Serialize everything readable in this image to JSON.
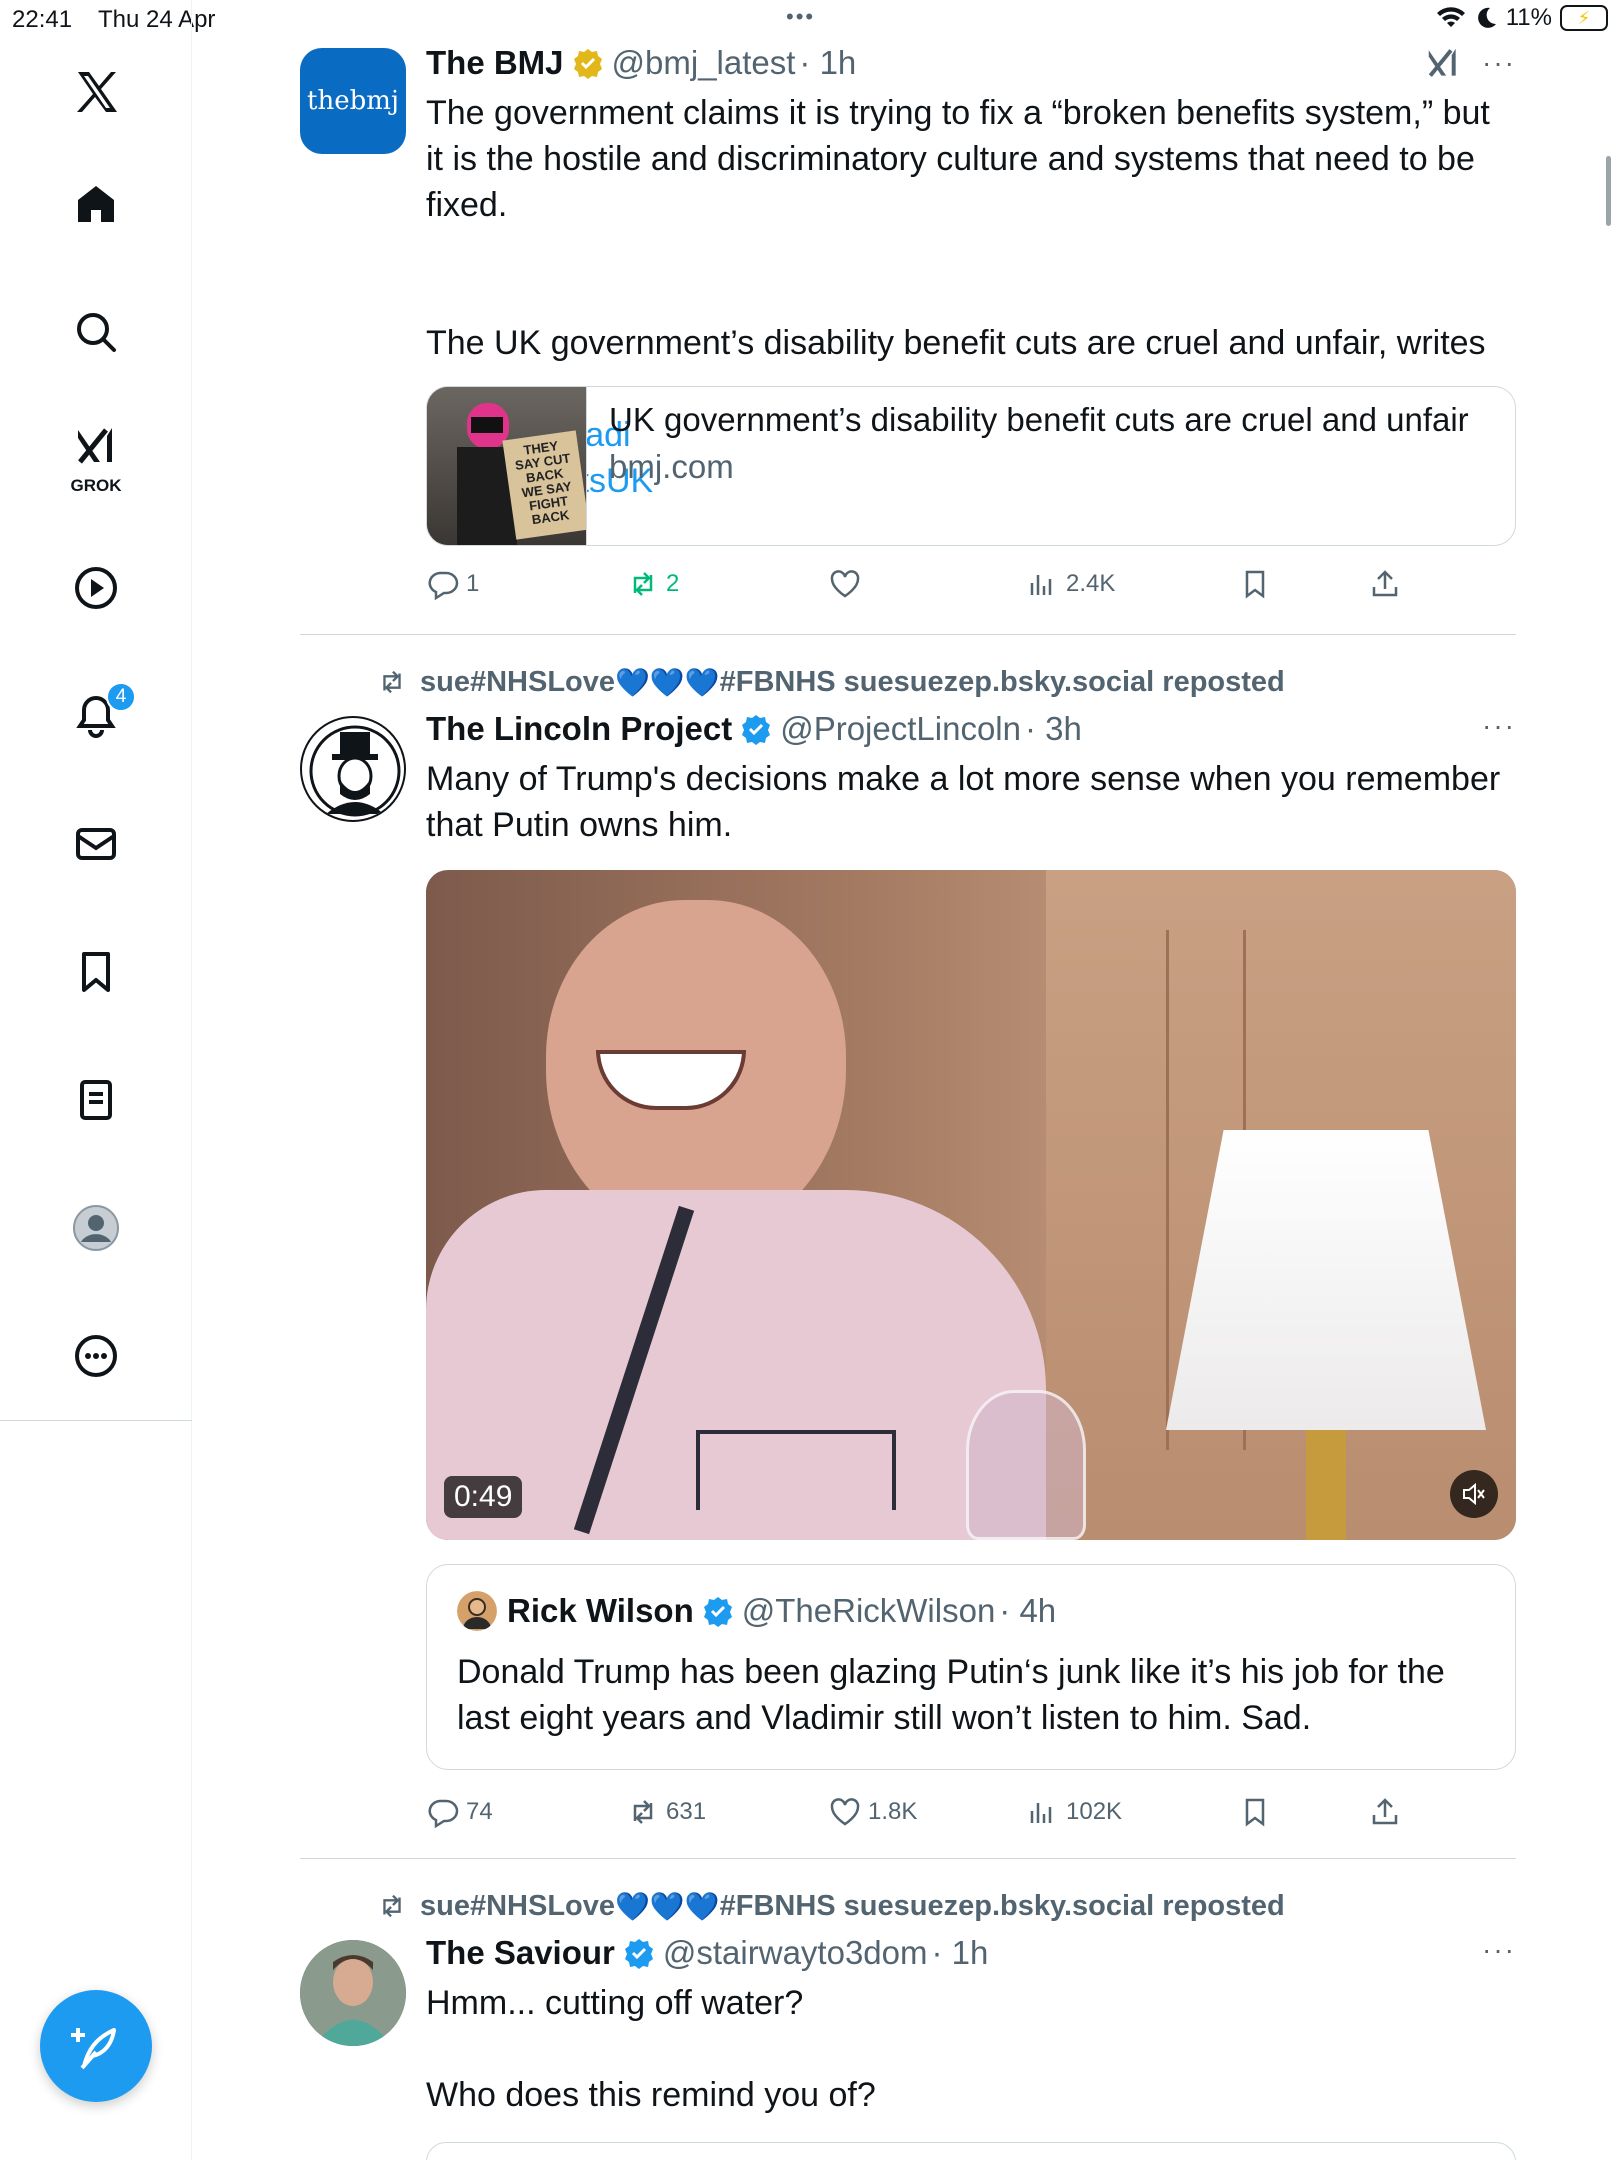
{
  "status_bar": {
    "time": "22:41",
    "date": "Thu 24 Apr",
    "battery": "11%"
  },
  "nav": {
    "grok_label": "GROK",
    "notification_count": "4",
    "items": [
      "x-logo",
      "home",
      "search",
      "grok",
      "video",
      "notifications",
      "messages",
      "bookmarks",
      "lists",
      "profile",
      "more"
    ]
  },
  "tweets": [
    {
      "author": "The BMJ",
      "avatar_text": "thebmj",
      "verified": "gold",
      "handle": "@bmj_latest",
      "time": "· 1h",
      "text": "The government claims it is trying to fix a “broken benefits system,” but it is the hostile and discriminatory culture and systems that need to be fixed.",
      "text2": "The UK government’s disability benefit cuts are cruel and unfair, writes",
      "mentions": [
        "@FaziletHadi",
        "@DisRightsUK"
      ],
      "card": {
        "title": "UK government’s disability benefit cuts are cruel and unfair",
        "domain": "bmj.com",
        "thumb_sign": "THEY SAY CUT BACK WE SAY FIGHT BACK"
      },
      "stats": {
        "replies": "1",
        "reposts": "2",
        "likes": "",
        "views": "2.4K"
      }
    },
    {
      "reposted_by": "sue#NHSLove",
      "reposted_tail": "#FBNHS suesuezep.bsky.social reposted",
      "author": "The Lincoln Project",
      "handle": "@ProjectLincoln",
      "time": "· 3h",
      "text": "Many of Trump's decisions make a lot more sense when you remember that Putin owns him.",
      "video_duration": "0:49",
      "quote": {
        "author": "Rick Wilson",
        "handle": "@TheRickWilson",
        "time": "· 4h",
        "text": "Donald Trump has been glazing Putin‘s junk like it’s his job for the last eight years and Vladimir still won’t listen to him. Sad."
      },
      "stats": {
        "replies": "74",
        "reposts": "631",
        "likes": "1.8K",
        "views": "102K"
      }
    },
    {
      "reposted_by": "sue#NHSLove",
      "reposted_tail": "#FBNHS suesuezep.bsky.social reposted",
      "author": "The Saviour",
      "handle": "@stairwayto3dom",
      "time": "· 1h",
      "text": "Hmm... cutting off water?",
      "text2": "Who does this remind you of?"
    }
  ],
  "colors": {
    "accent": "#1d9bf0",
    "repost_green": "#00ba7c",
    "secondary_text": "#536471",
    "bmj_blue": "#0a6bc2"
  }
}
